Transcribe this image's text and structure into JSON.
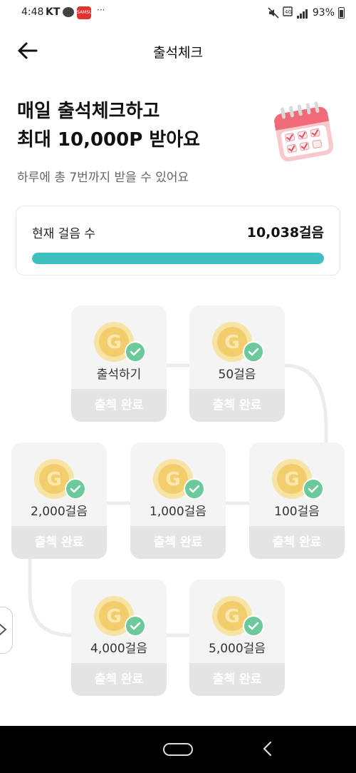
{
  "status_bar": {
    "time": "4:48",
    "carrier": "KT",
    "app_icon_text": "SAMSUNG",
    "more": "···",
    "battery": "93%"
  },
  "header": {
    "title": "출석체크"
  },
  "hero": {
    "headline_line1": "매일 출석체크하고",
    "headline_line2": "최대 10,000P 받아요",
    "subtitle": "하루에 총 7번까지 받을 수 있어요"
  },
  "steps": {
    "label": "현재 걸음 수",
    "value": "10,038걸음",
    "progress_percent": 100,
    "progress_color": "#3fbfbf"
  },
  "rewards": [
    {
      "label": "출석하기",
      "button": "출첵 완료",
      "status": "completed"
    },
    {
      "label": "50걸음",
      "button": "출첵 완료",
      "status": "completed"
    },
    {
      "label": "100걸음",
      "button": "출첵 완료",
      "status": "completed"
    },
    {
      "label": "1,000걸음",
      "button": "출첵 완료",
      "status": "completed"
    },
    {
      "label": "2,000걸음",
      "button": "출첵 완료",
      "status": "completed"
    },
    {
      "label": "4,000걸음",
      "button": "출첵 완료",
      "status": "completed"
    },
    {
      "label": "5,000걸음",
      "button": "출첵 완료",
      "status": "completed"
    }
  ],
  "colors": {
    "accent": "#3fbfbf",
    "check": "#6cc99c",
    "coin": "#f2cd6b",
    "card_bg": "#f4f4f4",
    "button_bg": "#e4e4e4"
  },
  "icons": {
    "back": "arrow-left-icon",
    "calendar": "calendar-icon",
    "coin": "coin-g-icon",
    "check": "check-icon",
    "side": "chevron-right-icon"
  }
}
